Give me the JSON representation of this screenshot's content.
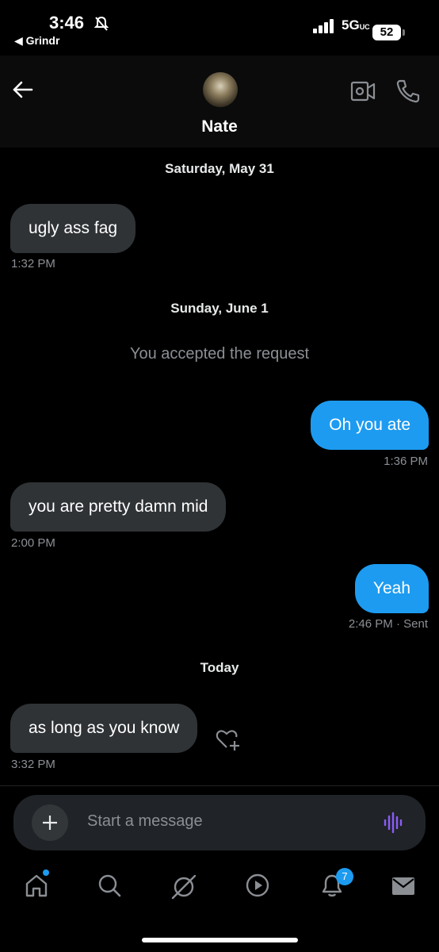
{
  "status_bar": {
    "time": "3:46",
    "back_app": "◀ Grindr",
    "network": "5G",
    "network_suffix": "UC",
    "battery": "52"
  },
  "header": {
    "contact_name": "Nate"
  },
  "conversation": {
    "day_1": "Saturday, May 31",
    "msg_1": {
      "text": "ugly ass fag",
      "time": "1:32 PM"
    },
    "day_2": "Sunday, June 1",
    "system_1": "You accepted the request",
    "msg_2": {
      "text": "Oh you ate",
      "time": "1:36 PM"
    },
    "msg_3": {
      "text": "you are pretty damn mid",
      "time": "2:00 PM"
    },
    "msg_4": {
      "text": "Yeah",
      "time": "2:46 PM",
      "status": "· Sent"
    },
    "day_3": "Today",
    "msg_5": {
      "text": "as long as you know",
      "time": "3:32 PM"
    }
  },
  "composer": {
    "placeholder": "Start a message"
  },
  "nav": {
    "notifications_badge": "7"
  },
  "colors": {
    "accent": "#1d9bf0",
    "incoming_bubble": "#2f3336",
    "background": "#000000",
    "voice_icon": "#8b5cf6"
  },
  "icons": [
    "bell-off-icon",
    "signal-icon",
    "back-arrow-icon",
    "video-call-icon",
    "phone-icon",
    "heart-add-icon",
    "plus-icon",
    "voice-icon",
    "home-icon",
    "search-icon",
    "grok-icon",
    "play-icon",
    "bell-icon",
    "mail-icon"
  ]
}
